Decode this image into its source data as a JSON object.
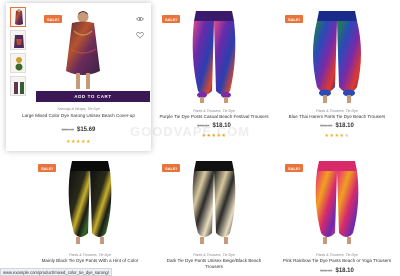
{
  "watermark": "GOODVAPE.COM",
  "status_url": "www.example.com/product/mixed_color_tie_dye_sarong/",
  "add_to_cart_label": "ADD TO CART",
  "products": [
    {
      "badge": "SALE!",
      "category": "Sarongs & Wraps, Tie Dye",
      "title": "Large Mixed Color Dye Sarong Unisex Beach Cover-up",
      "old_price": "$30.00",
      "new_price": "$15.69",
      "rating": 5
    },
    {
      "badge": "SALE!",
      "category": "Pants & Trousers, Tie Dye",
      "title": "Purple Tie Dye Posts Casual Beach Festival Trousers",
      "old_price": "$36.00",
      "new_price": "$18.10",
      "rating": 5
    },
    {
      "badge": "SALE!",
      "category": "Pants & Trousers, Tie Dye",
      "title": "Blue Thai Harem Parts Tie Dye Beach Trousers",
      "old_price": "$36.00",
      "new_price": "$18.10",
      "rating": 4
    },
    {
      "badge": "SALE!",
      "category": "Pants & Trousers, Tie Dye",
      "title": "Mainly Black Tie Dye Pants With a Hint of Color",
      "old_price": "",
      "new_price": "",
      "rating": 0
    },
    {
      "badge": "SALE!",
      "category": "Pants & Trousers, Tie Dye",
      "title": "Dark Tie Dye Pants Unisex Beige/Black Beach Trousers",
      "old_price": "",
      "new_price": "",
      "rating": 0
    },
    {
      "badge": "SALE!",
      "category": "Pants & Trousers, Tie Dye",
      "title": "Pink Rainbow Tie Dye Pants Beach or Yoga Trousers",
      "old_price": "$36.00",
      "new_price": "$18.10",
      "rating": 0
    }
  ],
  "colors": {
    "accent": "#e8743b",
    "cart": "#3a1855",
    "star": "#f2b01e"
  },
  "icons": {
    "quick_view": "eye-icon",
    "wishlist": "heart-icon"
  }
}
